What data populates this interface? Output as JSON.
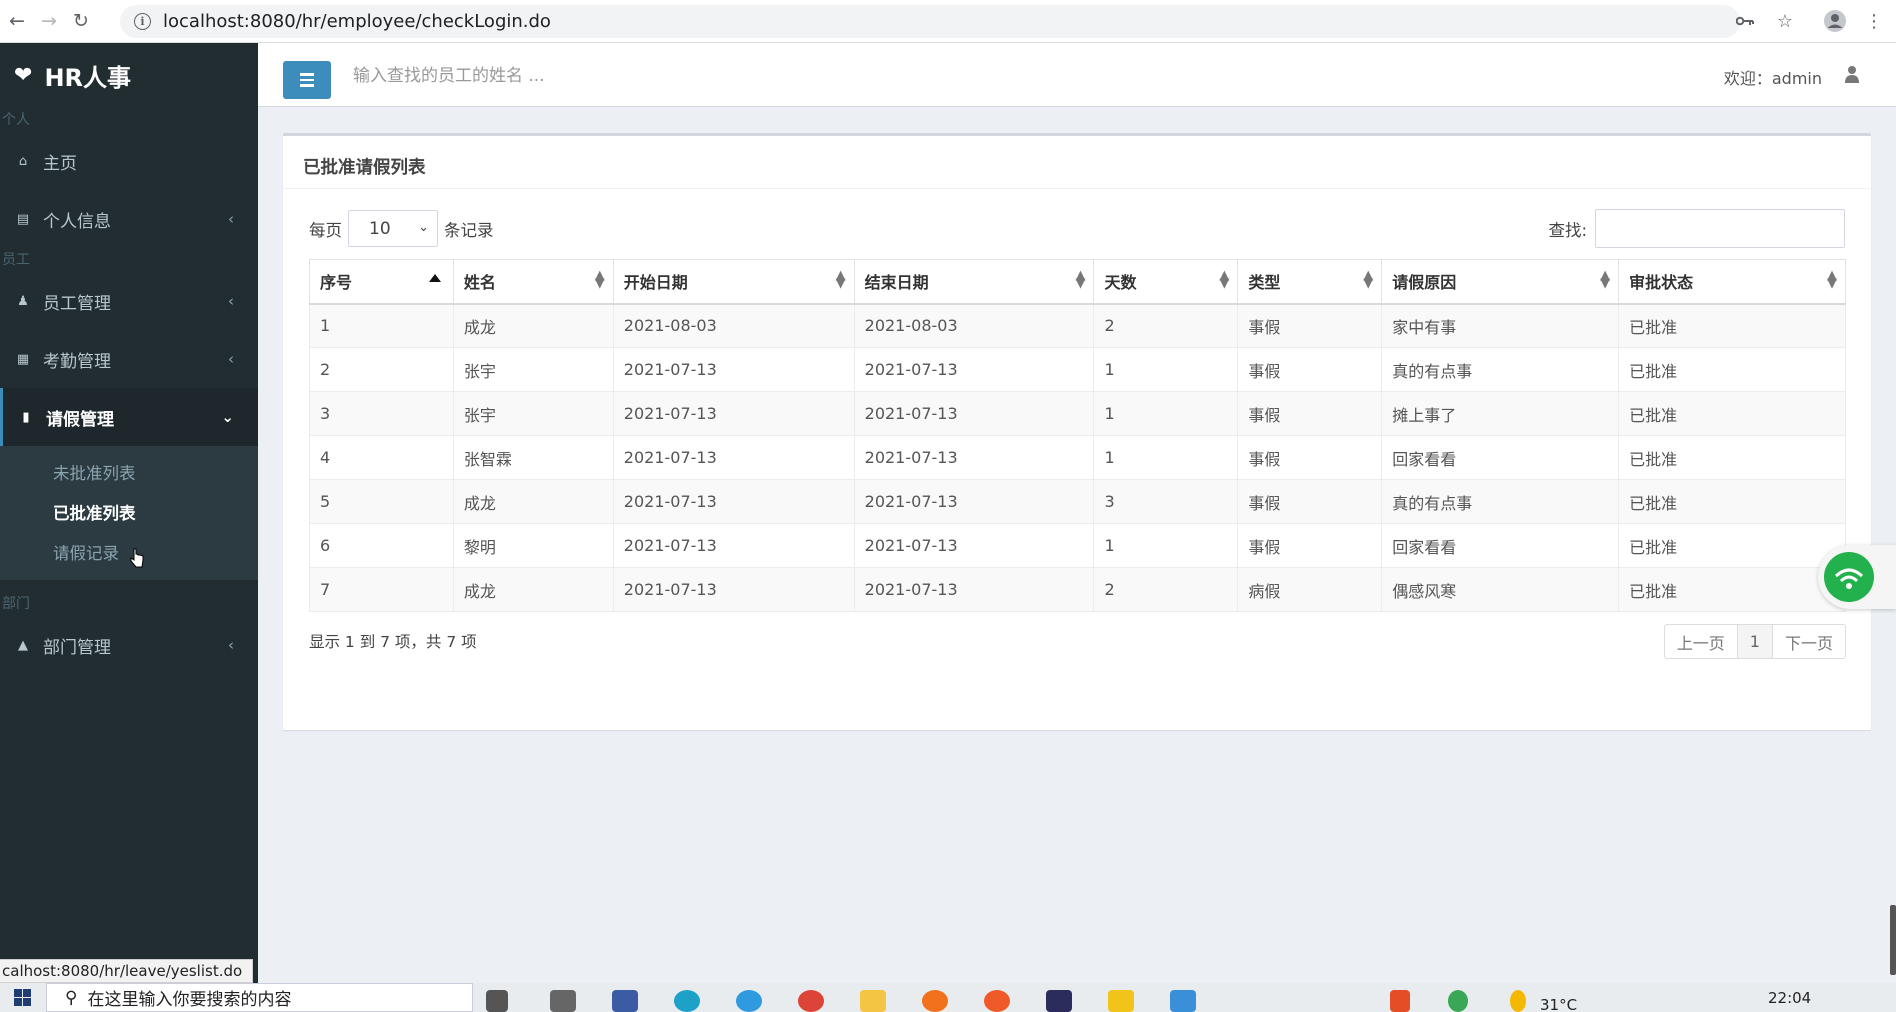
{
  "browser": {
    "url": "localhost:8080/hr/employee/checkLogin.do",
    "status_url": "calhost:8080/hr/leave/yeslist.do"
  },
  "sidebar": {
    "logo": "HR人事",
    "sections": {
      "personal": "个人",
      "employee": "员工",
      "department": "部门"
    },
    "items": {
      "home": "主页",
      "profile": "个人信息",
      "employee_mgmt": "员工管理",
      "attendance_mgmt": "考勤管理",
      "leave_mgmt": "请假管理",
      "dept_mgmt": "部门管理"
    },
    "leave_submenu": [
      "未批准列表",
      "已批准列表",
      "请假记录"
    ]
  },
  "header": {
    "search_placeholder": "输入查找的员工的姓名 ...",
    "welcome": "欢迎：admin"
  },
  "box": {
    "title": "已批准请假列表",
    "per_page_prefix": "每页",
    "per_page_value": "10",
    "per_page_suffix": "条记录",
    "search_label": "查找:",
    "columns": [
      "序号",
      "姓名",
      "开始日期",
      "结束日期",
      "天数",
      "类型",
      "请假原因",
      "审批状态"
    ],
    "rows": [
      [
        "1",
        "成龙",
        "2021-08-03",
        "2021-08-03",
        "2",
        "事假",
        "家中有事",
        "已批准"
      ],
      [
        "2",
        "张宇",
        "2021-07-13",
        "2021-07-13",
        "1",
        "事假",
        "真的有点事",
        "已批准"
      ],
      [
        "3",
        "张宇",
        "2021-07-13",
        "2021-07-13",
        "1",
        "事假",
        "摊上事了",
        "已批准"
      ],
      [
        "4",
        "张智霖",
        "2021-07-13",
        "2021-07-13",
        "1",
        "事假",
        "回家看看",
        "已批准"
      ],
      [
        "5",
        "成龙",
        "2021-07-13",
        "2021-07-13",
        "3",
        "事假",
        "真的有点事",
        "已批准"
      ],
      [
        "6",
        "黎明",
        "2021-07-13",
        "2021-07-13",
        "1",
        "事假",
        "回家看看",
        "已批准"
      ],
      [
        "7",
        "成龙",
        "2021-07-13",
        "2021-07-13",
        "2",
        "病假",
        "偶感风寒",
        "已批准"
      ]
    ],
    "info": "显示 1 到 7 项，共 7 项",
    "pager": {
      "prev": "上一页",
      "current": "1",
      "next": "下一页"
    }
  },
  "taskbar": {
    "search_placeholder": "在这里输入你要搜索的内容",
    "weather": "31°C",
    "time": "22:04"
  },
  "colors": {
    "sidebar_bg": "#222d32",
    "accent": "#3c8dbc",
    "content_bg": "#ecf0f5"
  }
}
